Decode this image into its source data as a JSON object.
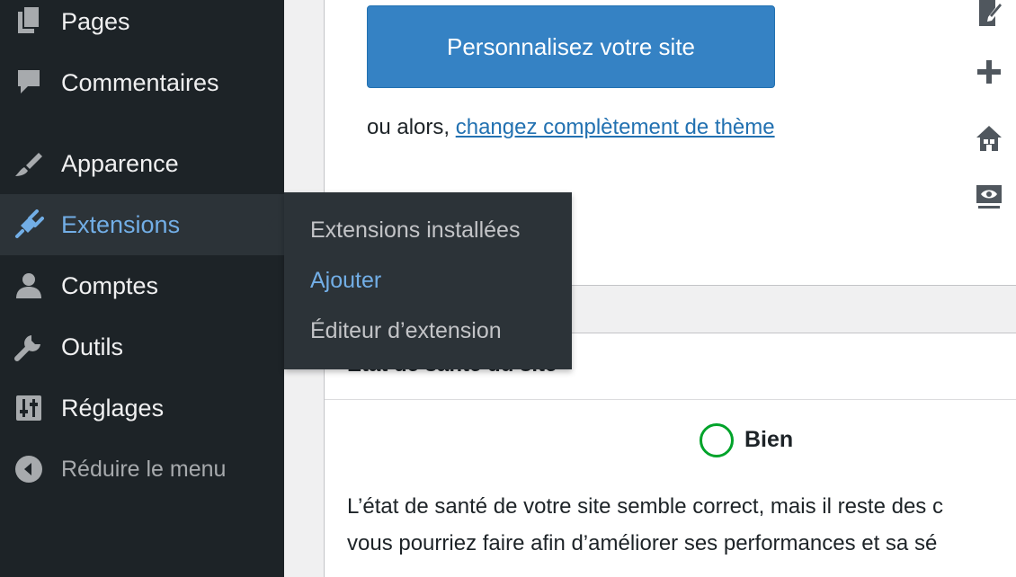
{
  "sidebar": {
    "items": [
      {
        "key": "pages",
        "label": "Pages",
        "icon": "pages-icon"
      },
      {
        "key": "comments",
        "label": "Commentaires",
        "icon": "comment-icon"
      },
      {
        "key": "appearance",
        "label": "Apparence",
        "icon": "paintbrush-icon"
      },
      {
        "key": "plugins",
        "label": "Extensions",
        "icon": "plugin-icon",
        "active": true
      },
      {
        "key": "users",
        "label": "Comptes",
        "icon": "user-icon"
      },
      {
        "key": "tools",
        "label": "Outils",
        "icon": "wrench-icon"
      },
      {
        "key": "settings",
        "label": "Réglages",
        "icon": "settings-sliders-icon"
      }
    ],
    "collapse_label": "Réduire le menu"
  },
  "flyout": {
    "items": [
      {
        "label": "Extensions installées",
        "current": false
      },
      {
        "label": "Ajouter",
        "current": true
      },
      {
        "label": "Éditeur d’extension",
        "current": false
      }
    ]
  },
  "welcome": {
    "customize_button": "Personnalisez votre site",
    "or_text": "ou alors, ",
    "change_theme_link": "changez complètement de thème"
  },
  "right_icons": [
    "edit-icon",
    "plus-icon",
    "home-icon",
    "view-icon"
  ],
  "site_health": {
    "title": "État de santé du site",
    "status": "Bien",
    "description_line1": "L’état de santé de votre site semble correct, mais il reste des c",
    "description_line2": "vous pourriez faire afin d’améliorer ses performances et sa sé"
  },
  "colors": {
    "sidebar_bg": "#1d2327",
    "submenu_bg": "#2c3338",
    "accent": "#72aee6",
    "button_bg": "#3582c4",
    "link": "#2271b1",
    "health_good": "#00a32a"
  }
}
